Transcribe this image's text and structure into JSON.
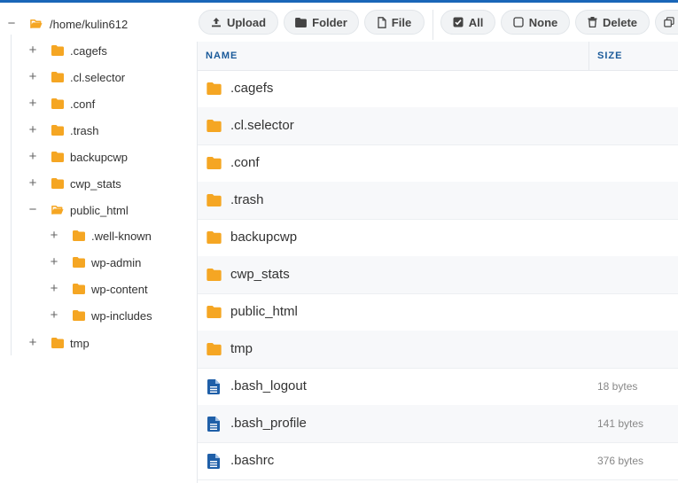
{
  "tree": {
    "root": {
      "label": "/home/kulin612",
      "toggle": "−"
    },
    "items": [
      {
        "label": ".cagefs",
        "toggle": "+"
      },
      {
        "label": ".cl.selector",
        "toggle": "+"
      },
      {
        "label": ".conf",
        "toggle": "+"
      },
      {
        "label": ".trash",
        "toggle": "+"
      },
      {
        "label": "backupcwp",
        "toggle": "+"
      },
      {
        "label": "cwp_stats",
        "toggle": "+"
      },
      {
        "label": "public_html",
        "toggle": "−"
      },
      {
        "label": ".well-known",
        "toggle": "+"
      },
      {
        "label": "wp-admin",
        "toggle": "+"
      },
      {
        "label": "wp-content",
        "toggle": "+"
      },
      {
        "label": "wp-includes",
        "toggle": "+"
      },
      {
        "label": "tmp",
        "toggle": "+"
      }
    ]
  },
  "toolbar": {
    "upload": "Upload",
    "folder": "Folder",
    "file": "File",
    "all": "All",
    "none": "None",
    "delete": "Delete"
  },
  "table": {
    "columns": {
      "name": "NAME",
      "size": "SIZE"
    },
    "rows": [
      {
        "name": ".cagefs",
        "size": "",
        "type": "folder"
      },
      {
        "name": ".cl.selector",
        "size": "",
        "type": "folder"
      },
      {
        "name": ".conf",
        "size": "",
        "type": "folder"
      },
      {
        "name": ".trash",
        "size": "",
        "type": "folder"
      },
      {
        "name": "backupcwp",
        "size": "",
        "type": "folder"
      },
      {
        "name": "cwp_stats",
        "size": "",
        "type": "folder"
      },
      {
        "name": "public_html",
        "size": "",
        "type": "folder"
      },
      {
        "name": "tmp",
        "size": "",
        "type": "folder"
      },
      {
        "name": ".bash_logout",
        "size": "18 bytes",
        "type": "file"
      },
      {
        "name": ".bash_profile",
        "size": "141 bytes",
        "type": "file"
      },
      {
        "name": ".bashrc",
        "size": "376 bytes",
        "type": "file"
      }
    ]
  },
  "colors": {
    "accent": "#1a66b8",
    "folder": "#f5a623",
    "file": "#1f5fa8"
  }
}
